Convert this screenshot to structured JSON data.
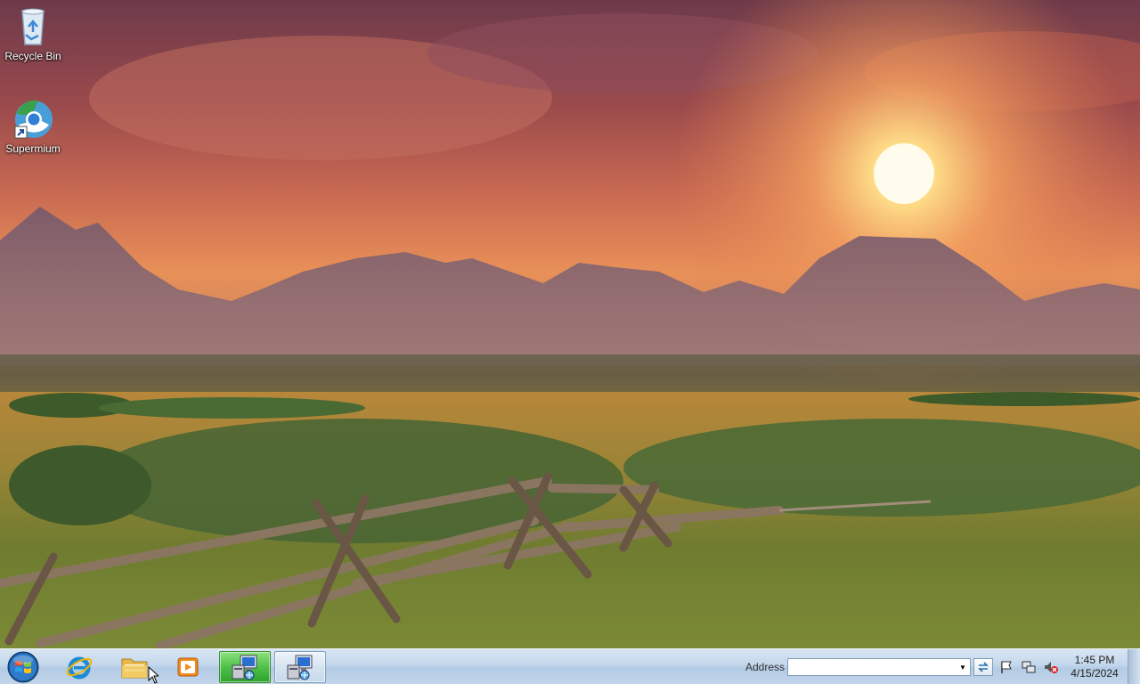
{
  "desktop": {
    "icons": [
      {
        "label": "Recycle Bin",
        "icon": "recycle-bin-icon"
      },
      {
        "label": "Supermium",
        "icon": "supermium-browser-icon"
      }
    ]
  },
  "taskbar": {
    "start": {
      "icon": "windows-start-orb-icon"
    },
    "pinned": [
      {
        "name": "internet-explorer",
        "icon": "internet-explorer-icon"
      },
      {
        "name": "file-explorer",
        "icon": "folder-icon"
      },
      {
        "name": "media-player",
        "icon": "media-player-icon"
      },
      {
        "name": "computer-app-active",
        "icon": "computer-network-icon"
      },
      {
        "name": "computer-app",
        "icon": "computer-network-icon"
      }
    ],
    "address": {
      "label": "Address",
      "value": ""
    },
    "tray": [
      {
        "name": "action-center",
        "icon": "flag-icon"
      },
      {
        "name": "network",
        "icon": "network-icon"
      },
      {
        "name": "volume",
        "icon": "speaker-muted-icon"
      }
    ],
    "clock": {
      "time": "1:45 PM",
      "date": "4/15/2024"
    }
  },
  "colors": {
    "taskbar": "#c3d7ec",
    "active_button": "#4fc14a"
  }
}
